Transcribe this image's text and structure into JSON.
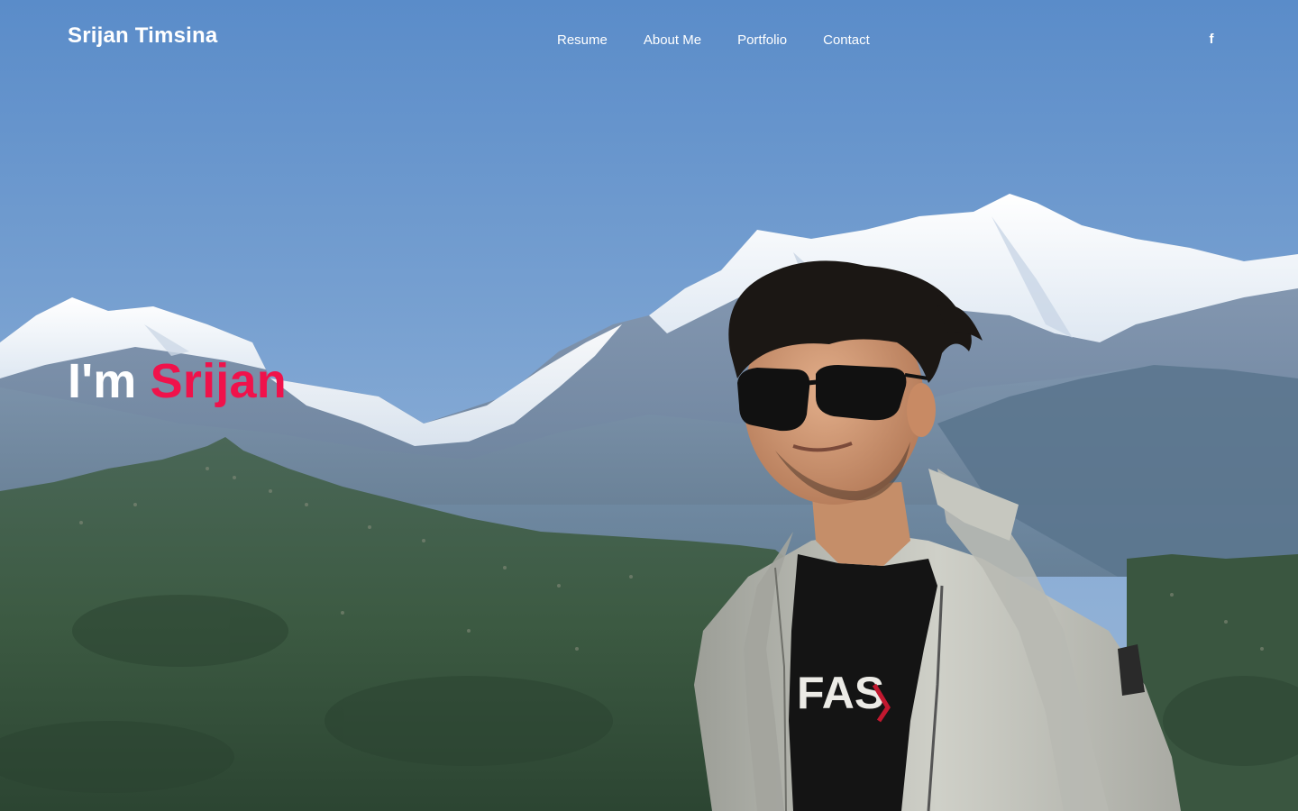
{
  "header": {
    "brand": "Srijan Timsina",
    "nav": {
      "resume": "Resume",
      "about": "About Me",
      "portfolio": "Portfolio",
      "contact": "Contact"
    },
    "social": {
      "facebook_glyph": "f",
      "icon": "facebook-icon"
    }
  },
  "hero": {
    "prefix": "I'm",
    "name": "Srijan",
    "shirt_text": "FAS",
    "colors": {
      "accent": "#f0124b",
      "text": "#ffffff",
      "sky": "#6f9ad0"
    },
    "image": "mountain-portrait-photo"
  }
}
